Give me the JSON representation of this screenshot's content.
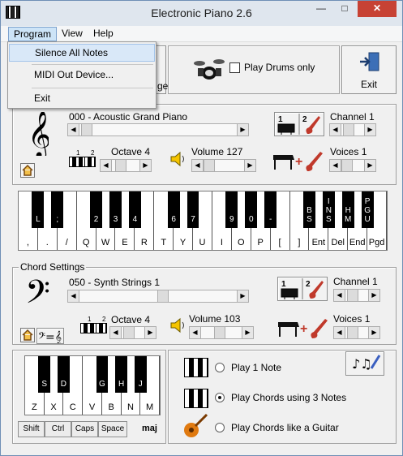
{
  "window": {
    "title": "Electronic Piano 2.6",
    "min": "—",
    "max": "□",
    "close": "✕"
  },
  "menu": {
    "program": "Program",
    "view": "View",
    "help": "Help"
  },
  "dropdown": {
    "items": [
      "Silence All Notes",
      "MIDI Out Device...",
      "Exit"
    ],
    "hidden_toolbar_label": "ge"
  },
  "toolbar": {
    "drums_label": "Play Drums only",
    "drums_checked": false,
    "exit_label": "Exit"
  },
  "top_piano": {
    "instrument": "000 - Acoustic Grand Piano",
    "octave_label": "Octave 4",
    "volume_label": "Volume 127",
    "channel_label": "Channel 1",
    "voices_label": "Voices 1",
    "tab_numbers": [
      "1",
      "2"
    ],
    "black_keys": [
      "L",
      ";",
      "2",
      "3",
      "4",
      "6",
      "7",
      "9",
      "0",
      "-",
      "BS",
      "INS",
      "HM",
      "PGU"
    ],
    "white_keys": [
      ",",
      ".",
      "/",
      "Q",
      "W",
      "E",
      "R",
      "T",
      "Y",
      "U",
      "I",
      "O",
      "P",
      "[",
      "]",
      "Ent",
      "Del",
      "End",
      "Pgd"
    ]
  },
  "chord": {
    "group_label": "Chord Settings",
    "instrument": "050 - Synth Strings 1",
    "octave_label": "Octave 4",
    "volume_label": "Volume 103",
    "channel_label": "Channel 1",
    "voices_label": "Voices 1",
    "black_keys": [
      "S",
      "D",
      "G",
      "H",
      "J"
    ],
    "white_keys": [
      "Z",
      "X",
      "C",
      "V",
      "B",
      "N",
      "M"
    ],
    "modifiers": [
      "Shift",
      "Ctrl",
      "Caps",
      "Space"
    ],
    "chord_type": "maj",
    "options": [
      "Play 1 Note",
      "Play Chords using 3 Notes",
      "Play Chords like a Guitar"
    ],
    "selected_option": 1
  },
  "colors": {
    "accent": "#0078d7",
    "close": "#c74234",
    "guitar": "#c0392b"
  }
}
